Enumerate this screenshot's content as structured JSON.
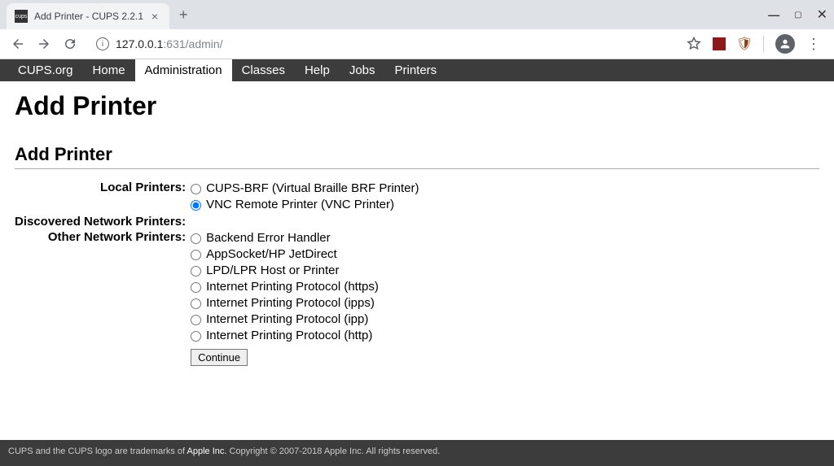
{
  "browser": {
    "tab_title": "Add Printer - CUPS 2.2.1",
    "favicon_text": "cups",
    "url_host": "127.0.0.1",
    "url_port_path": ":631/admin/"
  },
  "nav": {
    "items": [
      "CUPS.org",
      "Home",
      "Administration",
      "Classes",
      "Help",
      "Jobs",
      "Printers"
    ],
    "active_index": 2
  },
  "page": {
    "h1": "Add Printer",
    "h2": "Add Printer",
    "sections": {
      "local_label": "Local Printers:",
      "discovered_label": "Discovered Network Printers:",
      "other_label": "Other Network Printers:"
    },
    "local_printers": [
      {
        "label": "CUPS-BRF (Virtual Braille BRF Printer)",
        "selected": false
      },
      {
        "label": "VNC Remote Printer (VNC Printer)",
        "selected": true
      }
    ],
    "other_printers": [
      {
        "label": "Backend Error Handler",
        "selected": false
      },
      {
        "label": "AppSocket/HP JetDirect",
        "selected": false
      },
      {
        "label": "LPD/LPR Host or Printer",
        "selected": false
      },
      {
        "label": "Internet Printing Protocol (https)",
        "selected": false
      },
      {
        "label": "Internet Printing Protocol (ipps)",
        "selected": false
      },
      {
        "label": "Internet Printing Protocol (ipp)",
        "selected": false
      },
      {
        "label": "Internet Printing Protocol (http)",
        "selected": false
      }
    ],
    "continue_label": "Continue"
  },
  "footer": {
    "text_prefix": "CUPS and the CUPS logo are trademarks of ",
    "trademark": "Apple Inc.",
    "text_suffix": " Copyright © 2007-2018 Apple Inc. All rights reserved."
  }
}
